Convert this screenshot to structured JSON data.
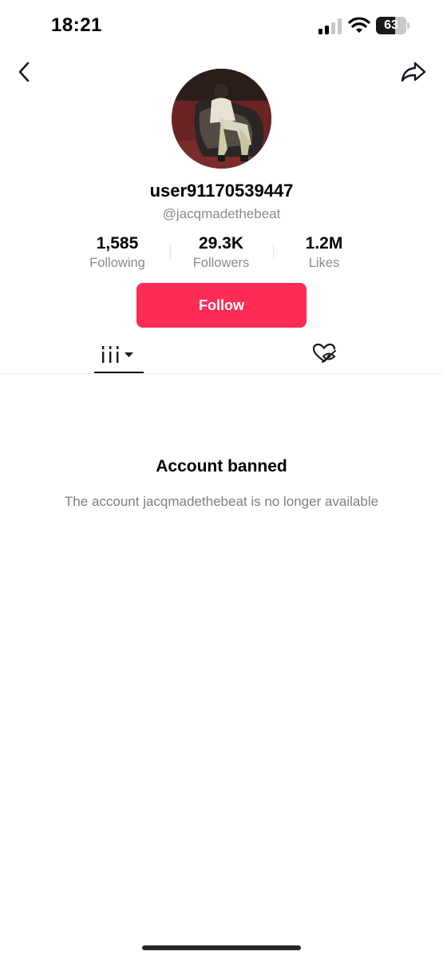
{
  "status_bar": {
    "time": "18:21",
    "battery_level": "63",
    "icons": [
      "signal-icon",
      "wifi-icon",
      "battery-icon"
    ]
  },
  "nav": {
    "back_icon": "chevron-left-icon",
    "share_icon": "share-arrow-icon"
  },
  "profile": {
    "display_name": "user91170539447",
    "handle": "@jacqmadethebeat",
    "stats": [
      {
        "value": "1,585",
        "label": "Following"
      },
      {
        "value": "29.3K",
        "label": "Followers"
      },
      {
        "value": "1.2M",
        "label": "Likes"
      }
    ],
    "follow_label": "Follow"
  },
  "tabs": {
    "videos_icon": "grid-bars-icon",
    "liked_icon": "hidden-heart-icon"
  },
  "empty_state": {
    "title": "Account banned",
    "message": "The account jacqmadethebeat is no longer available"
  },
  "colors": {
    "accent": "#fe2c55",
    "text_primary": "#161823",
    "text_secondary": "#8a8b91"
  }
}
